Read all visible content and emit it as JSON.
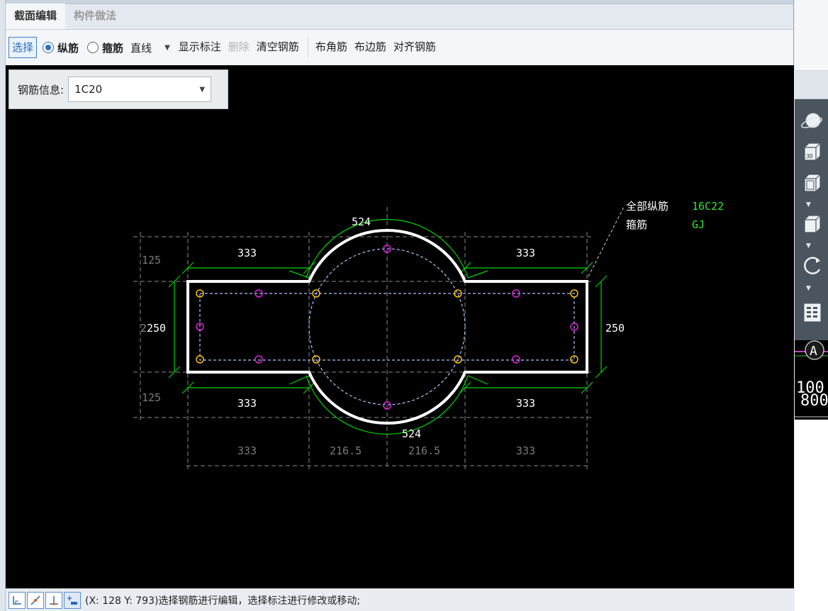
{
  "tabs": [
    {
      "label": "截面编辑",
      "active": true
    },
    {
      "label": "构件做法",
      "active": false
    }
  ],
  "toolbar": {
    "select": "选择",
    "radio_longitudinal": "纵筋",
    "radio_stirrup": "箍筋",
    "line_type": "直线",
    "show_annotation": "显示标注",
    "delete": "删除",
    "clear_rebar": "清空钢筋",
    "corner_rebar": "布角筋",
    "edge_rebar": "布边筋",
    "align_rebar": "对齐钢筋"
  },
  "rebar_info": {
    "label": "钢筋信息:",
    "value": "1C20"
  },
  "drawing": {
    "dims": {
      "arc_top": "524",
      "arc_bottom": "524",
      "top_left": "333",
      "top_right": "333",
      "bottom_left": "333",
      "bottom_right": "333",
      "height_left": "250",
      "height_left_prefix": "2",
      "height_right": "250",
      "offset_top": "125",
      "offset_bottom": "125",
      "row_1": "333",
      "row_2": "216.5",
      "row_3": "216.5",
      "row_4": "333"
    },
    "legend": {
      "all_longitudinal_label": "全部纵筋",
      "all_longitudinal_value": "16C22",
      "stirrup_label": "箍筋",
      "stirrup_value": "GJ"
    },
    "colors": {
      "outline": "#ffffff",
      "dimension": "#00d200",
      "corner_bar": "#ffc000",
      "edge_bar": "#e020e0",
      "stirrup": "#8fb6ff",
      "grid": "#9a9a9a"
    }
  },
  "status": {
    "text": "(X: 128 Y: 793)选择钢筋进行编辑，选择标注进行修改或移动;"
  },
  "right_panel": {
    "icons": [
      "orbit-icon",
      "view-3d-icon",
      "view-front-icon",
      "view-box-icon",
      "rotate-icon",
      "layers-grid-icon"
    ],
    "view_3d_label": "3D",
    "marker_label": "A",
    "fragment_top": "100",
    "fragment_bottom": "800"
  }
}
